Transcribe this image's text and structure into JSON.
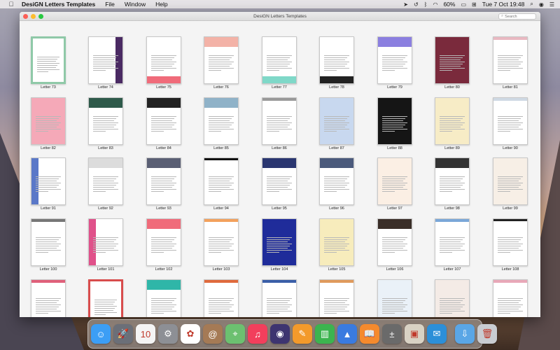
{
  "menubar": {
    "app_name": "DesiGN Letters Templates",
    "menus": [
      "File",
      "Window",
      "Help"
    ],
    "battery": "60%",
    "clock": "Tue 7 Oct  19:48"
  },
  "window": {
    "title": "DesiGN Letters Templates",
    "search_placeholder": "Search"
  },
  "templates": [
    {
      "label": "Letter 73",
      "style": "frame-green",
      "accent": "#8fc9a8"
    },
    {
      "label": "Letter 74",
      "style": "side-right",
      "accent": "#4a2a63"
    },
    {
      "label": "Letter 75",
      "style": "band-bottom",
      "accent": "#f06b7a"
    },
    {
      "label": "Letter 76",
      "style": "band-top",
      "accent": "#f3b2a7"
    },
    {
      "label": "Letter 77",
      "style": "band-bottom",
      "accent": "#7fd8c8"
    },
    {
      "label": "Letter 78",
      "style": "band-bottom",
      "accent": "#222222"
    },
    {
      "label": "Letter 79",
      "style": "band-top",
      "accent": "#8b7fe0"
    },
    {
      "label": "Letter 80",
      "style": "full",
      "accent": "#7a2a3c"
    },
    {
      "label": "Letter 81",
      "style": "plain",
      "accent": "#e9b8c1"
    },
    {
      "label": "Letter 82",
      "style": "full",
      "accent": "#f5a9b8"
    },
    {
      "label": "Letter 83",
      "style": "band-top",
      "accent": "#2e5a4a"
    },
    {
      "label": "Letter 84",
      "style": "band-top",
      "accent": "#222222"
    },
    {
      "label": "Letter 85",
      "style": "band-top",
      "accent": "#8fb2c8"
    },
    {
      "label": "Letter 86",
      "style": "plain",
      "accent": "#999999"
    },
    {
      "label": "Letter 87",
      "style": "full",
      "accent": "#c8d8ef"
    },
    {
      "label": "Letter 88",
      "style": "full",
      "accent": "#151515"
    },
    {
      "label": "Letter 89",
      "style": "full",
      "accent": "#f7ecc6"
    },
    {
      "label": "Letter 90",
      "style": "plain",
      "accent": "#cfd9e4"
    },
    {
      "label": "Letter 91",
      "style": "side-left",
      "accent": "#5a78c8"
    },
    {
      "label": "Letter 92",
      "style": "band-top",
      "accent": "#dcdcdc"
    },
    {
      "label": "Letter 93",
      "style": "band-top",
      "accent": "#5a5f74"
    },
    {
      "label": "Letter 94",
      "style": "heading",
      "accent": "#111111"
    },
    {
      "label": "Letter 95",
      "style": "band-top",
      "accent": "#2a3670"
    },
    {
      "label": "Letter 96",
      "style": "band-top",
      "accent": "#4b5a7c"
    },
    {
      "label": "Letter 97",
      "style": "full",
      "accent": "#fbefe4"
    },
    {
      "label": "Letter 98",
      "style": "band-top",
      "accent": "#333333"
    },
    {
      "label": "Letter 99",
      "style": "full",
      "accent": "#f7efe6"
    },
    {
      "label": "Letter 100",
      "style": "plain",
      "accent": "#777777"
    },
    {
      "label": "Letter 101",
      "style": "side-left",
      "accent": "#e0518a"
    },
    {
      "label": "Letter 102",
      "style": "band-top",
      "accent": "#f06b7a"
    },
    {
      "label": "Letter 103",
      "style": "plain",
      "accent": "#f3a15c"
    },
    {
      "label": "Letter 104",
      "style": "full",
      "accent": "#1f2c9a"
    },
    {
      "label": "Letter 105",
      "style": "full",
      "accent": "#f7ecbc"
    },
    {
      "label": "Letter 106",
      "style": "band-top",
      "accent": "#3a2e28"
    },
    {
      "label": "Letter 107",
      "style": "plain",
      "accent": "#7aa7d8"
    },
    {
      "label": "Letter 108",
      "style": "heading",
      "accent": "#222222"
    },
    {
      "label": "",
      "style": "plain",
      "accent": "#e0607a"
    },
    {
      "label": "",
      "style": "frame-red",
      "accent": "#d84c4c"
    },
    {
      "label": "",
      "style": "band-top",
      "accent": "#2fb6a8"
    },
    {
      "label": "",
      "style": "plain",
      "accent": "#e06a3c"
    },
    {
      "label": "",
      "style": "plain",
      "accent": "#3a5ea8"
    },
    {
      "label": "",
      "style": "plain",
      "accent": "#e09a5c"
    },
    {
      "label": "",
      "style": "full",
      "accent": "#eaf1f8"
    },
    {
      "label": "",
      "style": "full",
      "accent": "#f4ebe6"
    },
    {
      "label": "",
      "style": "plain",
      "accent": "#e8a8b8"
    }
  ],
  "dock": [
    {
      "name": "finder-icon",
      "color": "#3c9ef5",
      "glyph": "☺"
    },
    {
      "name": "launchpad-icon",
      "color": "#6b6f78",
      "glyph": "🚀"
    },
    {
      "name": "calendar-icon",
      "color": "#f4f4f4",
      "glyph": "10"
    },
    {
      "name": "system-preferences-icon",
      "color": "#8d8f95",
      "glyph": "⚙"
    },
    {
      "name": "photos-icon",
      "color": "#ffffff",
      "glyph": "✿"
    },
    {
      "name": "contacts-icon",
      "color": "#a57a55",
      "glyph": "@"
    },
    {
      "name": "maps-icon",
      "color": "#6cc070",
      "glyph": "⌖"
    },
    {
      "name": "music-icon",
      "color": "#f23f5c",
      "glyph": "♫"
    },
    {
      "name": "siri-icon",
      "color": "#3d3470",
      "glyph": "◉"
    },
    {
      "name": "pages-icon",
      "color": "#f39a2b",
      "glyph": "✎"
    },
    {
      "name": "numbers-icon",
      "color": "#3cb44f",
      "glyph": "▥"
    },
    {
      "name": "keynote-icon",
      "color": "#3a7be0",
      "glyph": "▲"
    },
    {
      "name": "books-icon",
      "color": "#f58a2d",
      "glyph": "📖"
    },
    {
      "name": "calculator-icon",
      "color": "#6a6a6a",
      "glyph": "±"
    },
    {
      "name": "preview-icon",
      "color": "#d9d2c4",
      "glyph": "▣"
    },
    {
      "name": "design-letters-icon",
      "color": "#2c8fd8",
      "glyph": "✉"
    },
    {
      "name": "downloads-folder-icon",
      "color": "#5aa6e6",
      "glyph": "⇩"
    },
    {
      "name": "trash-icon",
      "color": "#c9ccd1",
      "glyph": "🗑"
    }
  ]
}
